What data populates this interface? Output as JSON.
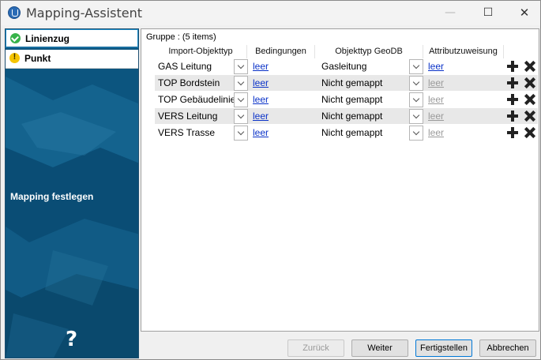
{
  "window": {
    "title": "Mapping-Assistent",
    "controls": {
      "minimize": "—",
      "maximize": "☐",
      "close": "✕"
    }
  },
  "sidebar": {
    "items": [
      {
        "label": "Linienzug",
        "status": "ok",
        "active": true
      },
      {
        "label": "Punkt",
        "status": "warning",
        "active": false
      }
    ],
    "caption": "Mapping festlegen",
    "help": "?"
  },
  "grid": {
    "group_label": "Gruppe :  (5 items)",
    "columns": [
      "Import-Objekttyp",
      "Bedingungen",
      "Objekttyp GeoDB",
      "Attributzuweisung"
    ],
    "rows": [
      {
        "import_type": "GAS Leitung",
        "conditions": "leer",
        "geodb_type": "Gasleitung",
        "attribute": "leer",
        "attribute_enabled": true
      },
      {
        "import_type": "TOP Bordstein",
        "conditions": "leer",
        "geodb_type": "Nicht gemappt",
        "attribute": "leer",
        "attribute_enabled": false
      },
      {
        "import_type": "TOP Gebäudelinie",
        "conditions": "leer",
        "geodb_type": "Nicht gemappt",
        "attribute": "leer",
        "attribute_enabled": false
      },
      {
        "import_type": "VERS Leitung",
        "conditions": "leer",
        "geodb_type": "Nicht gemappt",
        "attribute": "leer",
        "attribute_enabled": false
      },
      {
        "import_type": "VERS Trasse",
        "conditions": "leer",
        "geodb_type": "Nicht gemappt",
        "attribute": "leer",
        "attribute_enabled": false
      }
    ]
  },
  "footer": {
    "back": "Zurück",
    "next": "Weiter",
    "finish": "Fertigstellen",
    "cancel": "Abbrechen"
  },
  "colors": {
    "accent": "#0078d7",
    "link": "#0a32c8",
    "sidebar_bg": "#0d5a86",
    "ok": "#37b34a",
    "warning": "#f5c400"
  }
}
